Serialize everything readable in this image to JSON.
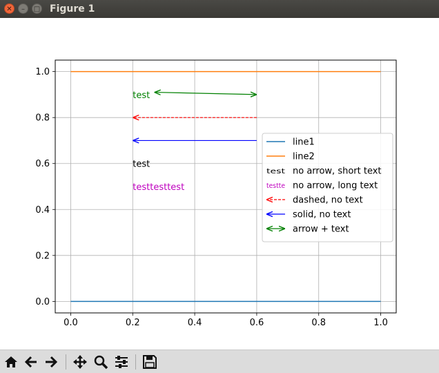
{
  "window": {
    "title": "Figure 1"
  },
  "toolbar": {
    "buttons": [
      {
        "name": "home-button",
        "icon": "home-icon"
      },
      {
        "name": "back-button",
        "icon": "arrow-left-icon"
      },
      {
        "name": "forward-button",
        "icon": "arrow-right-icon"
      },
      {
        "name": "pan-button",
        "icon": "move-icon"
      },
      {
        "name": "zoom-button",
        "icon": "zoom-icon"
      },
      {
        "name": "configure-button",
        "icon": "sliders-icon"
      },
      {
        "name": "save-button",
        "icon": "save-icon"
      }
    ]
  },
  "chart_data": {
    "type": "line",
    "xlim": [
      -0.05,
      1.05
    ],
    "ylim": [
      -0.05,
      1.05
    ],
    "xticks": [
      0.0,
      0.2,
      0.4,
      0.6,
      0.8,
      1.0
    ],
    "yticks": [
      0.0,
      0.2,
      0.4,
      0.6,
      0.8,
      1.0
    ],
    "xtick_labels": [
      "0.0",
      "0.2",
      "0.4",
      "0.6",
      "0.8",
      "1.0"
    ],
    "ytick_labels": [
      "0.0",
      "0.2",
      "0.4",
      "0.6",
      "0.8",
      "1.0"
    ],
    "grid": true,
    "series": [
      {
        "name": "line1",
        "color": "#1f77b4",
        "x": [
          0,
          1
        ],
        "y": [
          0,
          0
        ]
      },
      {
        "name": "line2",
        "color": "#ff7f0e",
        "x": [
          0,
          1
        ],
        "y": [
          1,
          1
        ]
      }
    ],
    "annotations": [
      {
        "legend": "no arrow, short text",
        "text": "test",
        "text_pos": [
          0.2,
          0.6
        ],
        "color": "#000000"
      },
      {
        "legend": "no arrow, long text",
        "text": "testtesttest",
        "text_pos": [
          0.2,
          0.5
        ],
        "color": "#bf00bf"
      },
      {
        "legend": "dashed, no text",
        "text": "",
        "from": [
          0.6,
          0.8
        ],
        "to": [
          0.2,
          0.8
        ],
        "color": "#ff0000",
        "dashed": true,
        "arrow": "end"
      },
      {
        "legend": "solid, no text",
        "text": "",
        "from": [
          0.6,
          0.7
        ],
        "to": [
          0.2,
          0.7
        ],
        "color": "#0000ff",
        "dashed": false,
        "arrow": "end"
      },
      {
        "legend": "arrow + text",
        "text": "test",
        "text_pos": [
          0.2,
          0.9
        ],
        "from": [
          0.27,
          0.91
        ],
        "to": [
          0.6,
          0.9
        ],
        "color": "#008000",
        "dashed": false,
        "arrow": "both"
      }
    ],
    "legend": {
      "location": "center-right",
      "entries": [
        {
          "label": "line1",
          "kind": "line",
          "color": "#1f77b4"
        },
        {
          "label": "line2",
          "kind": "line",
          "color": "#ff7f0e"
        },
        {
          "label": "no arrow, short text",
          "kind": "text",
          "sample": "test",
          "color": "#000000"
        },
        {
          "label": "no arrow, long text",
          "kind": "text",
          "sample": "testte",
          "color": "#bf00bf"
        },
        {
          "label": "dashed, no text",
          "kind": "arrow",
          "color": "#ff0000",
          "dashed": true
        },
        {
          "label": "solid, no text",
          "kind": "arrow",
          "color": "#0000ff",
          "dashed": false
        },
        {
          "label": "arrow + text",
          "kind": "arrow2",
          "color": "#008000",
          "dashed": false
        }
      ]
    }
  }
}
